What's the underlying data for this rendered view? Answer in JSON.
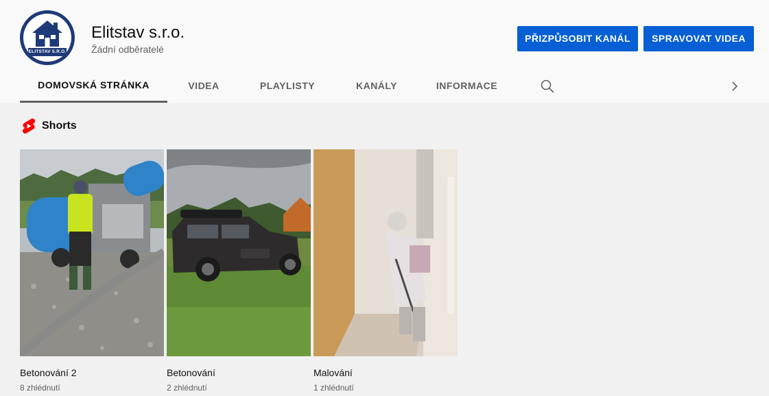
{
  "channel": {
    "name": "Elitstav s.r.o.",
    "subscribers": "Žádní odběratelé",
    "logo_text": "ELITSTAV S.R.O."
  },
  "buttons": {
    "customize": "PŘIZPŮSOBIT KANÁL",
    "manage": "SPRAVOVAT VIDEA"
  },
  "tabs": [
    {
      "label": "DOMOVSKÁ STRÁNKA",
      "active": true
    },
    {
      "label": "VIDEA",
      "active": false
    },
    {
      "label": "PLAYLISTY",
      "active": false
    },
    {
      "label": "KANÁLY",
      "active": false
    },
    {
      "label": "INFORMACE",
      "active": false
    }
  ],
  "icons": {
    "search": "search-icon",
    "next": "chevron-right-icon",
    "shorts": "shorts-logo-icon"
  },
  "shorts": {
    "title": "Shorts",
    "items": [
      {
        "title": "Betonování 2",
        "views": "8 zhlédnutí"
      },
      {
        "title": "Betonování",
        "views": "2 zhlédnutí"
      },
      {
        "title": "Malování",
        "views": "1 zhlédnutí"
      }
    ]
  },
  "colors": {
    "accent": "#065fd4",
    "shorts_red": "#ff0000",
    "logo_blue": "#1f3a78"
  }
}
